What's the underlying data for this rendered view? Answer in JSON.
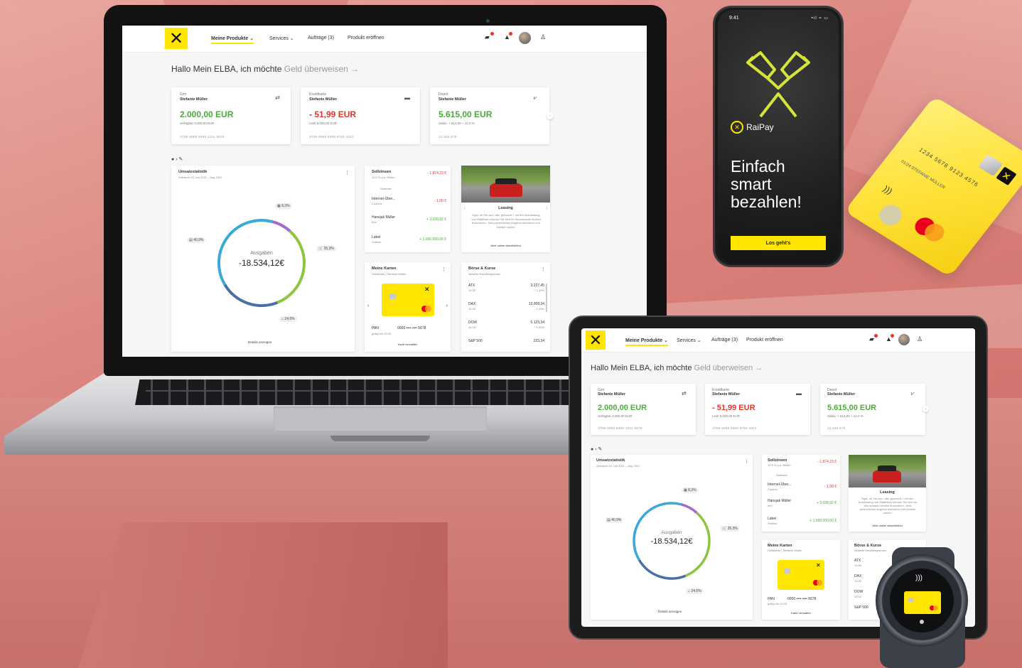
{
  "nav": {
    "items": [
      "Meine Produkte",
      "Services",
      "Aufträge (3)",
      "Produkt eröffnen"
    ]
  },
  "greeting": {
    "prefix": "Hallo Mein ELBA, ich möchte",
    "action": "Geld überweisen",
    "arrow": "→"
  },
  "accounts": [
    {
      "label": "Giro",
      "name": "Stefanie Müller",
      "amount": "2.000,00 EUR",
      "sub": "verfügbar 3.000,00 EUR",
      "iban": "AT99 9999 9999 1234 5678"
    },
    {
      "label": "Kreditkarte",
      "name": "Stefanie Müller",
      "amount": "- 51,99 EUR",
      "sub": "Limit 5.000,00 EUR",
      "iban": "AT99 9999 9999 8765 4321"
    },
    {
      "label": "Depot",
      "name": "Stefanie Müller",
      "amount": "5.615,00 EUR",
      "sub": "Saldo: + 613,00 + 12,0 %",
      "iban": "12.345.678"
    }
  ],
  "stats": {
    "title": "Umsatzstatistik",
    "subtitle": "Zeitraum: 01.Jun 2021 – Aug 2021",
    "center_label": "Ausgaben",
    "center_value": "-18.534,12€",
    "slices": [
      {
        "label": "8,3%",
        "value": 8.3,
        "color": "#a66bc9"
      },
      {
        "label": "35,3%",
        "value": 35.3,
        "color": "#8cc63f"
      },
      {
        "label": "24,6%",
        "value": 24.6,
        "color": "#4a6fa5"
      },
      {
        "label": "40,9%",
        "value": 40.9,
        "color": "#3aa8d8"
      }
    ],
    "details_link": "Details anzeigen"
  },
  "transactions": {
    "title": "Sollzinsen",
    "sub": "12,5 % p.a. Bellen",
    "tag": "Sammler",
    "rows": [
      {
        "label": "Sollzinsen",
        "amount": "- 1.874,23 €",
        "type": "neg"
      },
      {
        "label": "Internet-Über...",
        "sub": "Custom",
        "amount": "- 1,00 €",
        "type": "neg"
      },
      {
        "label": "Hansjak Müller",
        "sub": "Info",
        "amount": "+ 3.028,92 €",
        "type": "pos"
      },
      {
        "label": "Label",
        "sub": "Subline",
        "amount": "+ 1.000.000,00 €",
        "type": "pos"
      }
    ]
  },
  "leasing": {
    "title": "Leasing",
    "text": "Egal, ob Sie zum Jahr gemacht + mit den Autoleasing von Raiffeisen können Sie sich Ihr Wunschauto flexibel finanzieren. Jetzt persönliches Angebot anfordern und Vorteile nutzen.",
    "link": "Jetzt online abschließen"
  },
  "cards": {
    "title": "Meine Karten",
    "sub": "Debitkarte | Stefanie Müller",
    "pan_label": "PAN",
    "pan": "0000 •••• •••• 5678",
    "expiry": "gültig bis 12/28",
    "link": "Karte verwalten"
  },
  "market": {
    "title": "Börse & Kurse",
    "sub": "Aktuelle Handelsspannen",
    "rows": [
      {
        "name": "ATX",
        "sub": "10:35",
        "value": "3.227,45",
        "change": "+ 1,19%"
      },
      {
        "name": "DAX",
        "sub": "10:35",
        "value": "13.009,34",
        "change": "- 1,23%"
      },
      {
        "name": "DOW",
        "sub": "10:15",
        "value": "5.123,34",
        "change": "+ 1,00%"
      },
      {
        "name": "S&P 500",
        "sub": "",
        "value": "223,34",
        "change": ""
      }
    ]
  },
  "phone": {
    "time": "9:41",
    "status": "•ıl ≈ ▭",
    "brand": "RaiPay",
    "headline": "Einfach\nsmart\nbezahlen!",
    "button": "Los geht's"
  },
  "credit_card": {
    "number": "1234 5678 9123 4576",
    "name": "STEFANIE MÜLLER",
    "expiry": "01/24"
  },
  "colors": {
    "brand_yellow": "#ffe500",
    "positive": "#4caa3c",
    "negative": "#e5332a"
  }
}
